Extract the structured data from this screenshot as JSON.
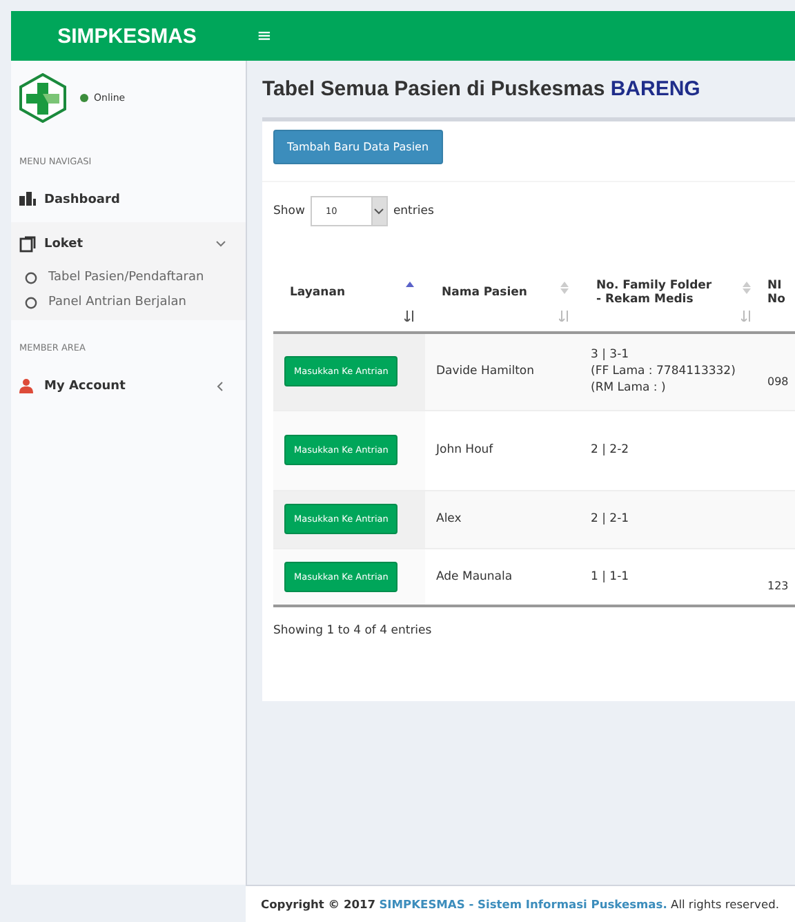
{
  "header": {
    "brand": "SIMPKESMAS",
    "menu_toggle": "≡"
  },
  "sidebar": {
    "user_status": "Online",
    "sections": [
      {
        "heading": "MENU NAVIGASI",
        "items": [
          {
            "label": "Dashboard"
          },
          {
            "label": "Loket",
            "expanded": true,
            "children": [
              {
                "label": "Tabel Pasien/Pendaftaran"
              },
              {
                "label": "Panel Antrian Berjalan"
              }
            ]
          }
        ]
      },
      {
        "heading": "MEMBER AREA",
        "items": [
          {
            "label": "My Account",
            "expanded": false
          }
        ]
      }
    ]
  },
  "page": {
    "title": "Tabel Semua Pasien di Puskesmas **BARENG**",
    "add_button": "Tambah Baru Data Pasien",
    "length": {
      "label_before": "Show",
      "value": "10",
      "label_after": "entries"
    },
    "table": {
      "columns": [
        {
          "lines": [
            "Layanan"
          ],
          "sorted": true
        },
        {
          "lines": [
            "Nama Pasien"
          ],
          "sorted": false
        },
        {
          "lines": [
            "No. Family Folder",
            "- Rekam Medis"
          ],
          "sorted": false
        },
        {
          "lines": [
            "NI",
            "No"
          ]
        }
      ],
      "rows": [
        {
          "action": "Masukkan Ke Antrian",
          "name": "Davide Hamilton",
          "folder": [
            "3 | 3-1",
            "(FF Lama : 7784113332)",
            "(RM Lama : )"
          ],
          "column_4": "098"
        },
        {
          "action": "Masukkan Ke Antrian",
          "name": "John Houf",
          "folder": [
            "2 | 2-2"
          ]
        },
        {
          "action": "Masukkan Ke Antrian",
          "name": "Alex",
          "folder": [
            "2 | 2-1"
          ]
        },
        {
          "action": "Masukkan Ke Antrian",
          "name": "Ade Maunala",
          "folder": [
            "1 | 1-1"
          ],
          "column_4": "123"
        }
      ]
    },
    "info": "Showing 1 to 4 of 4 entries"
  },
  "footer": {
    "text": "**Copyright © 2017** ",
    "link": "SIMPKESMAS - Sistem Informasi Puskesmas.",
    "rest": " All rights reserved."
  }
}
